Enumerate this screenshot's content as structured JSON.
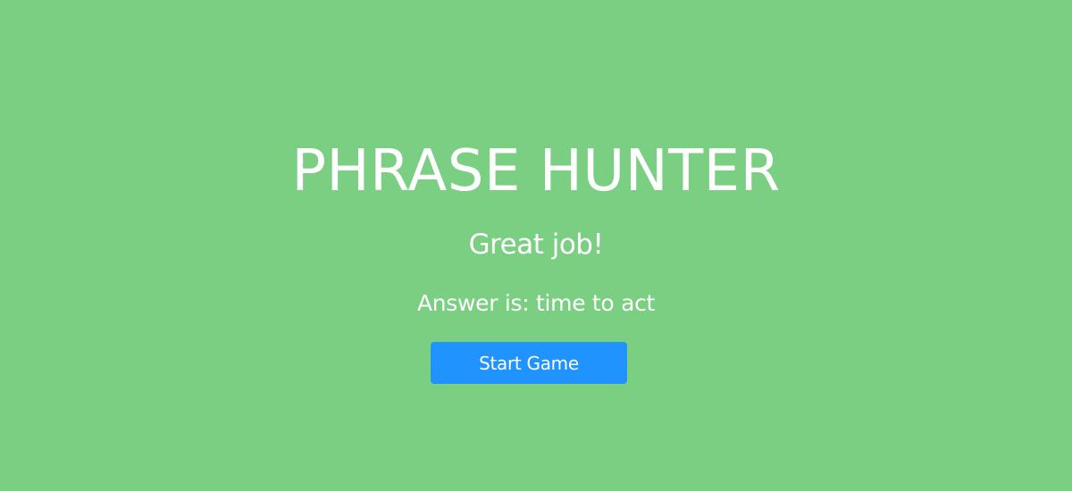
{
  "overlay": {
    "title": "PHRASE HUNTER",
    "message": "Great job!",
    "answer": "Answer is: time to act",
    "start_button_label": "Start Game"
  },
  "colors": {
    "background": "#7acf82",
    "button": "#2193ff",
    "text": "#ffffff"
  }
}
